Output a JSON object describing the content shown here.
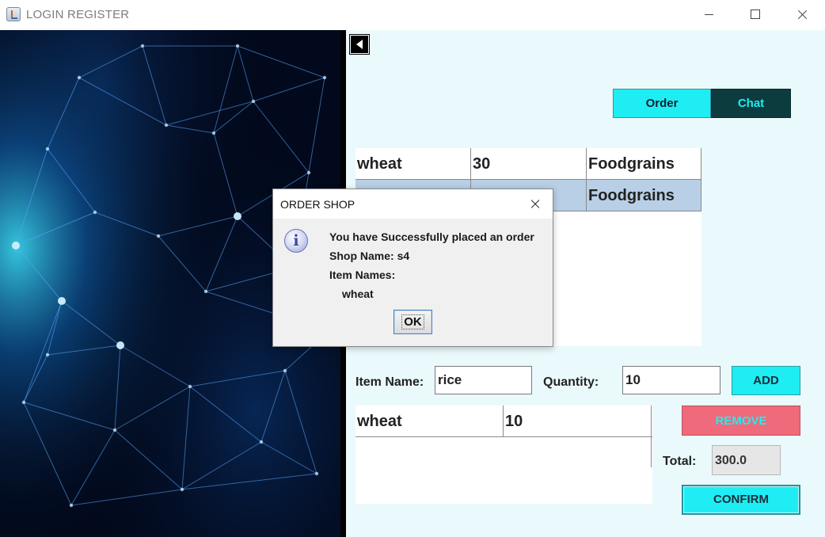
{
  "window": {
    "title": "LOGIN REGISTER"
  },
  "nav": {
    "order_tab": "Order",
    "chat_tab": "Chat"
  },
  "items_table": {
    "rows": [
      [
        "wheat",
        "30",
        "Foodgrains"
      ],
      [
        "",
        "",
        "Foodgrains"
      ]
    ]
  },
  "form": {
    "item_name_label": "Item Name:",
    "item_name_value": "rice",
    "quantity_label": "Quantity:",
    "quantity_value": "10",
    "add_label": "ADD"
  },
  "cart": {
    "rows": [
      [
        "wheat",
        "10"
      ]
    ]
  },
  "actions": {
    "remove_label": "REMOVE",
    "total_label": "Total:",
    "total_value": "300.0",
    "confirm_label": "CONFIRM"
  },
  "dialog": {
    "title": "ORDER SHOP",
    "line1": "You have Successfully placed an order",
    "line2": "Shop Name: s4",
    "line3": "Item Names:",
    "line4": "wheat",
    "ok_label": "OK"
  },
  "icons": {
    "app": "java-cup-icon",
    "back": "back-arrow-icon",
    "info": "info-icon"
  },
  "colors": {
    "accent_cyan": "#1eeef3",
    "chat_tab_bg": "#0d3c3e",
    "remove_bg": "#ef6a7a",
    "panel_bg": "#eaf9fc",
    "selected_row": "#b8cfe6"
  }
}
